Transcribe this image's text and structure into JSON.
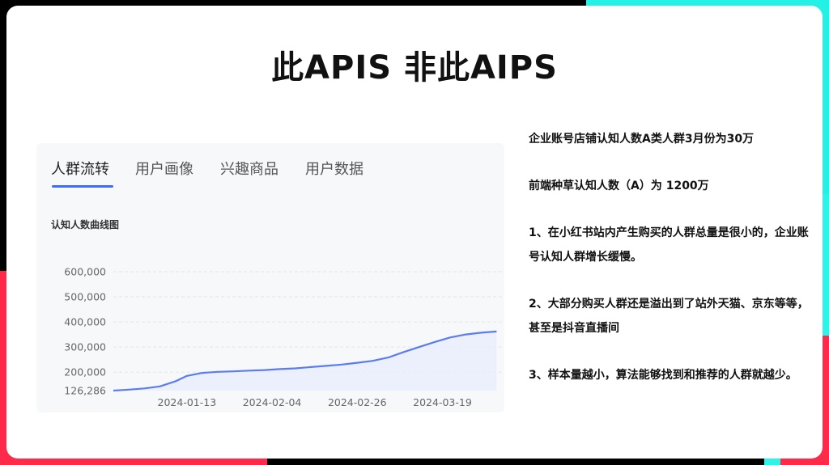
{
  "slide": {
    "title": "此APIS 非此AIPS",
    "tabs": [
      "人群流转",
      "用户画像",
      "兴趣商品",
      "用户数据"
    ],
    "active_tab": 0,
    "chart_title": "认知人数曲线图",
    "notes": [
      "企业账号店铺认知人数A类人群3月份为30万",
      "前端种草认知人数（A）为 1200万",
      "1、在小红书站内产生购买的人群总量是很小的，企业账号认知人群增长缓慢。",
      "2、大部分购买人群还是溢出到了站外天猫、京东等等，甚至是抖音直播间",
      "3、样本量越小，算法能够找到和推荐的人群就越少。"
    ]
  },
  "colors": {
    "accent": "#3e6cf4",
    "line": "#5b7cf0",
    "area": "#e9edfd",
    "background_red": "#ff2a49",
    "background_teal": "#24f1e6"
  },
  "chart_data": {
    "type": "area",
    "title": "认知人数曲线图",
    "xlabel": "",
    "ylabel": "",
    "ylim": [
      126286,
      600000
    ],
    "y_ticks": [
      "600,000",
      "500,000",
      "400,000",
      "300,000",
      "200,000",
      "126,286"
    ],
    "y_tick_values": [
      600000,
      500000,
      400000,
      300000,
      200000,
      126286
    ],
    "x_ticks": [
      "2024-01-13",
      "2024-02-04",
      "2024-02-26",
      "2024-03-19"
    ],
    "series": [
      {
        "x": [
          "2023-12-25",
          "2023-12-29",
          "2024-01-02",
          "2024-01-06",
          "2024-01-10",
          "2024-01-13",
          "2024-01-17",
          "2024-01-21",
          "2024-01-25",
          "2024-01-29",
          "2024-02-02",
          "2024-02-06",
          "2024-02-10",
          "2024-02-14",
          "2024-02-18",
          "2024-02-22",
          "2024-02-26",
          "2024-03-01",
          "2024-03-05",
          "2024-03-09",
          "2024-03-13",
          "2024-03-17",
          "2024-03-21",
          "2024-03-25",
          "2024-03-29",
          "2024-04-02"
        ],
        "values": [
          126286,
          130000,
          135000,
          143000,
          163000,
          185000,
          197000,
          201000,
          203000,
          206000,
          208000,
          212000,
          215000,
          220000,
          225000,
          230000,
          237000,
          245000,
          258000,
          280000,
          300000,
          320000,
          338000,
          350000,
          357000,
          362000
        ]
      }
    ]
  }
}
